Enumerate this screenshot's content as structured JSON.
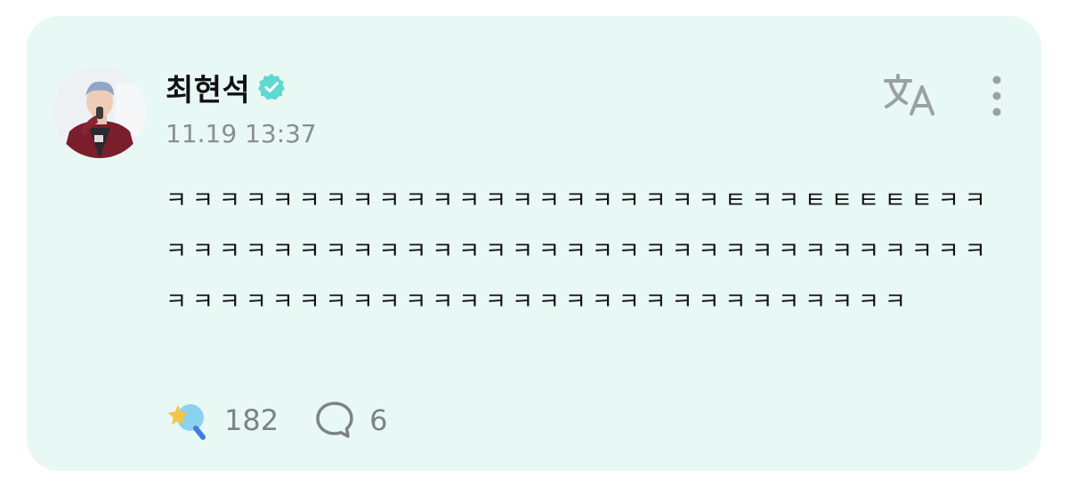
{
  "post": {
    "author_name": "최현석",
    "timestamp": "11.19 13:37",
    "body": "ㅋㅋㅋㅋㅋㅋㅋㅋㅋㅋㅋㅋㅋㅋㅋㅋㅋㅋㅋㅋㅋㅌㅋㅋㅌㅌㅌㅌㅌㅋㅋㅋㅋㅋㅋㅋㅋㅋㅋㅋㅋㅋㅋㅋㅋㅋㅋㅋㅋㅋㅋㅋㅋㅋㅋㅋㅋㅋㅋㅋㅋㅋㅋㅋㅋㅋㅋㅋㅋㅋㅋㅋㅋㅋㅋㅋㅋㅋㅋㅋㅋㅋㅋㅋㅋㅋㅋㅋㅋㅋ",
    "reaction_count": "182",
    "comment_count": "6"
  },
  "icons": {
    "verified": "verified-badge-icon",
    "translate": "translate-icon",
    "more": "more-vertical-icon",
    "reaction": "star-wand-reaction-icon",
    "comment": "speech-bubble-icon"
  },
  "colors": {
    "card_background": "#e8f8f4",
    "verified_badge": "#5ed8d0",
    "icon_gray": "#9aa0a3",
    "count_gray": "#7d8285"
  }
}
